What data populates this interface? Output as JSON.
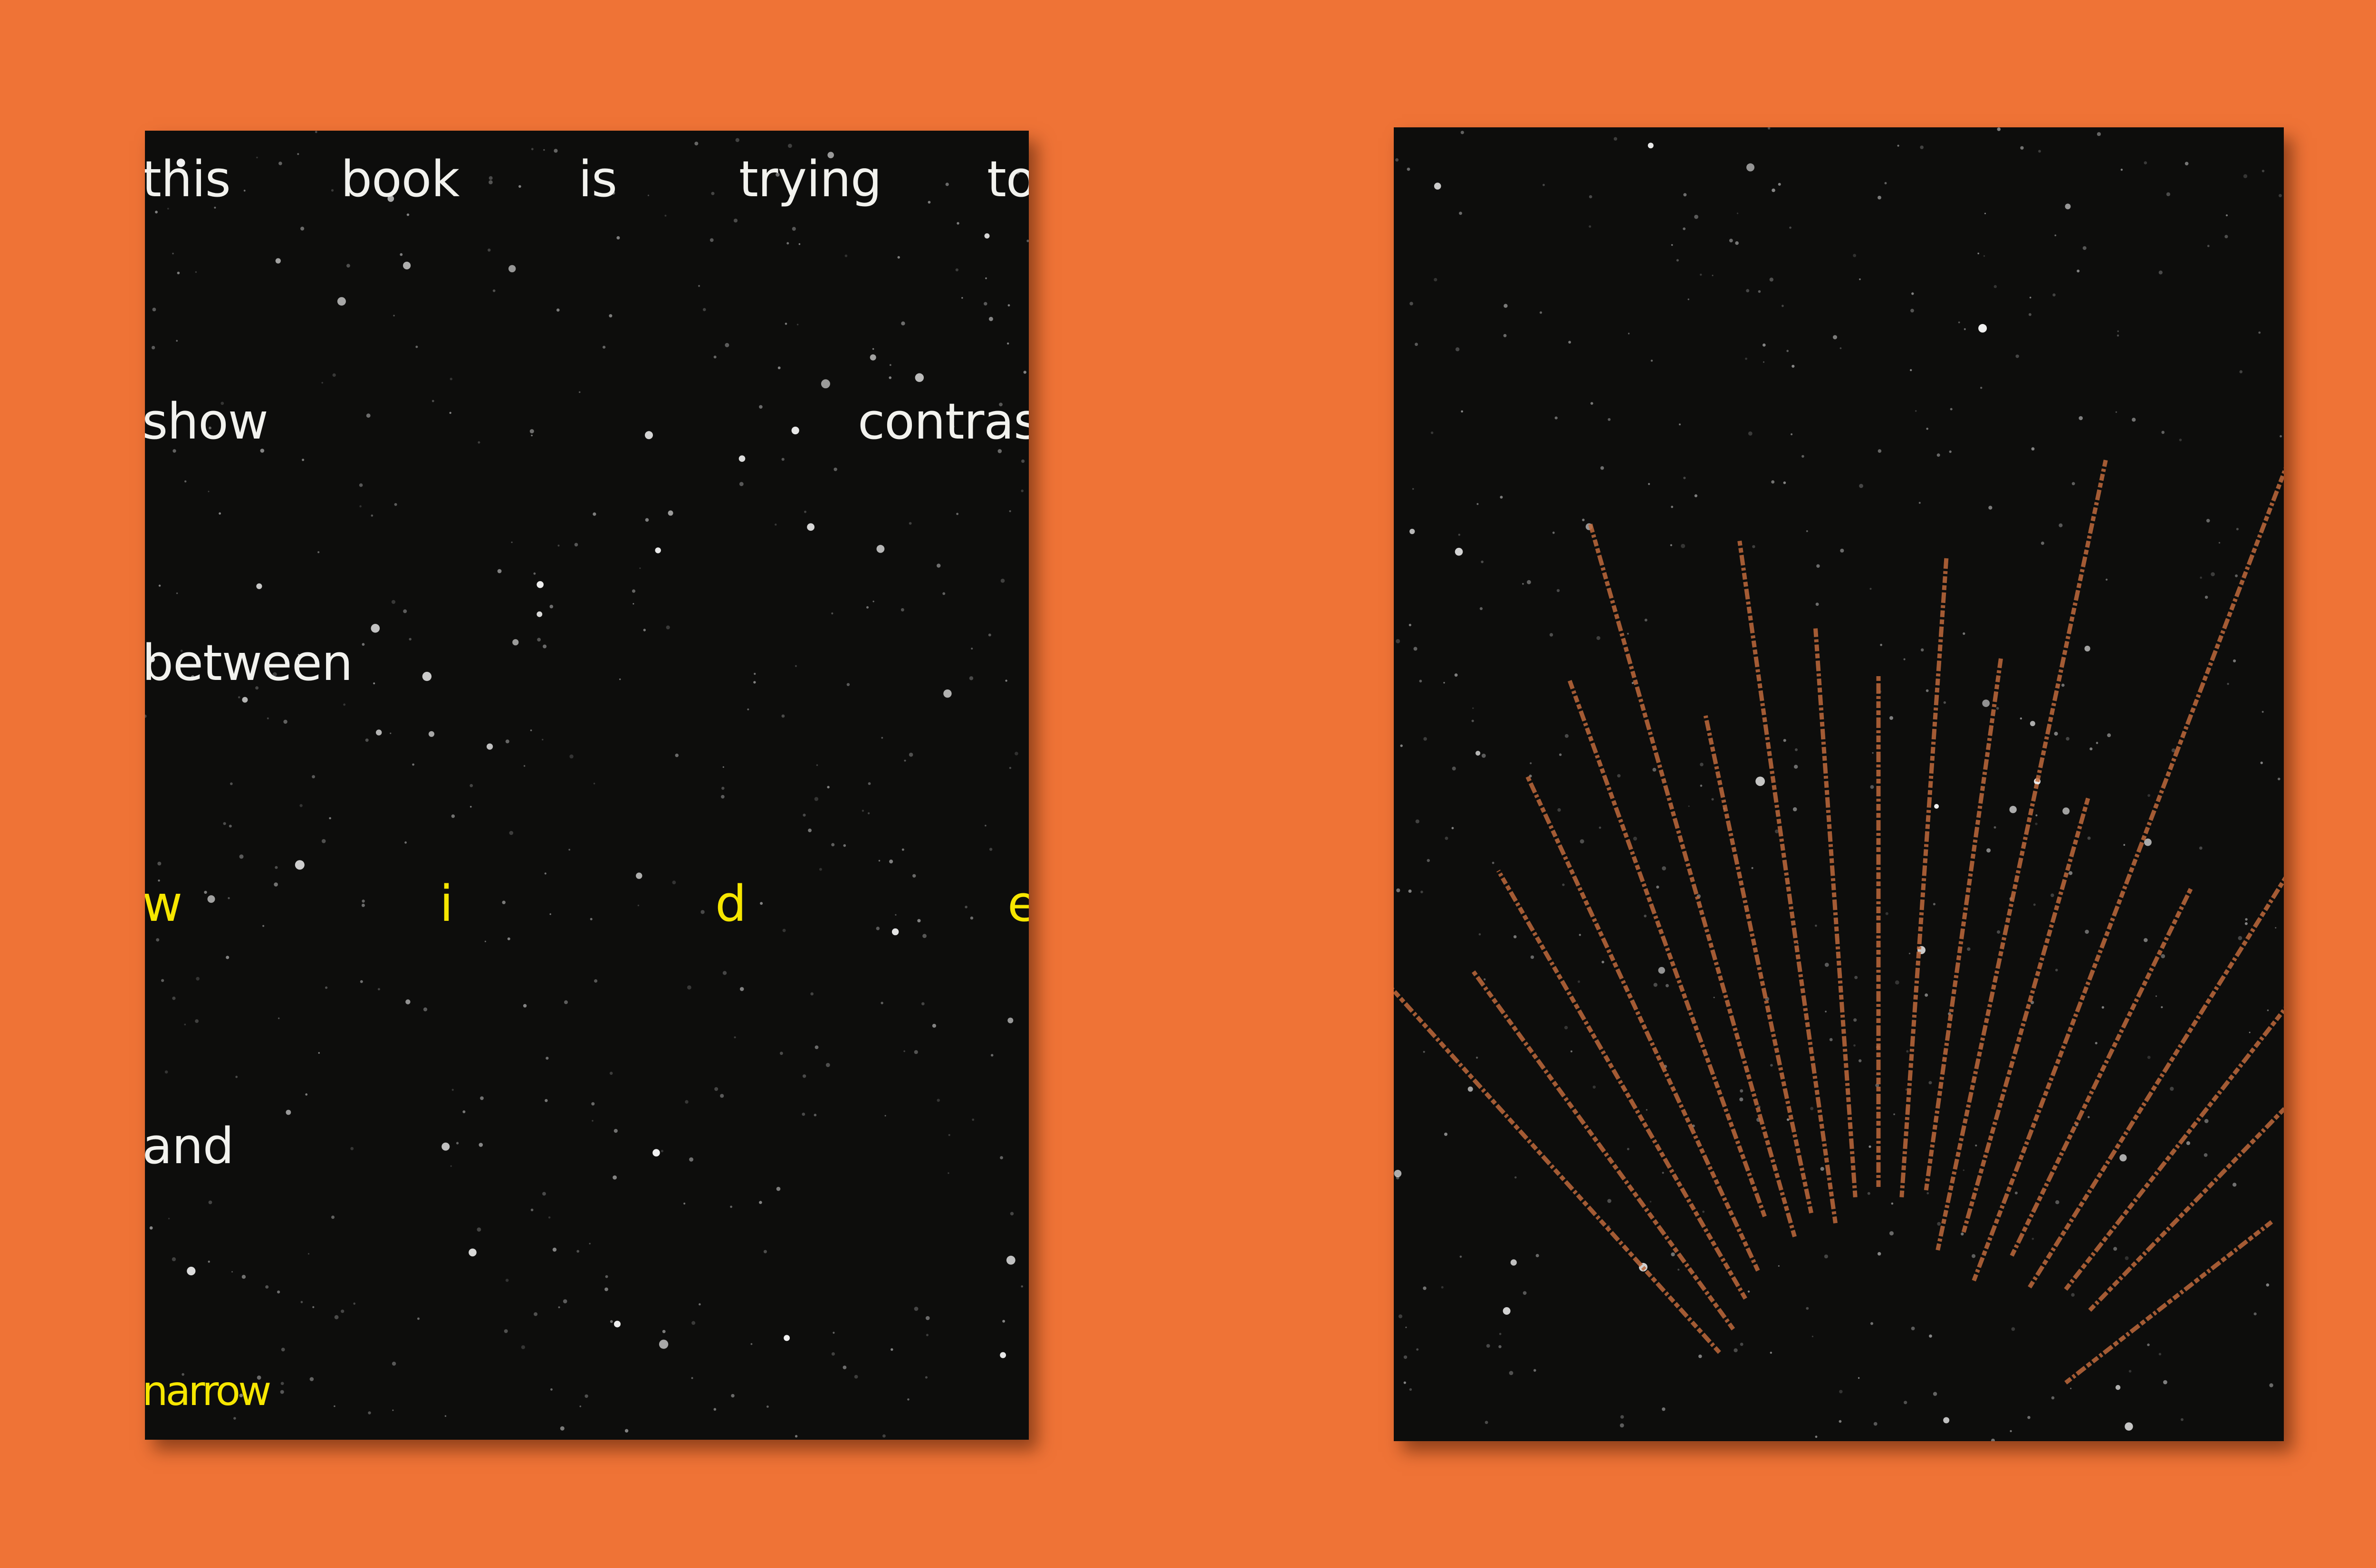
{
  "left_page": {
    "line1": [
      "this",
      "book",
      "is",
      "trying",
      "to"
    ],
    "line2": [
      "show",
      "contrast"
    ],
    "line3": "between",
    "line4": [
      "w",
      "i",
      "d",
      "e"
    ],
    "line5": "and",
    "line6": "narrow"
  },
  "colors": {
    "background": "#ef7336",
    "page": "#0d0d0c",
    "text": "#f2f2ee",
    "highlight": "#f6e600",
    "ray_text": "#c06a3c"
  }
}
